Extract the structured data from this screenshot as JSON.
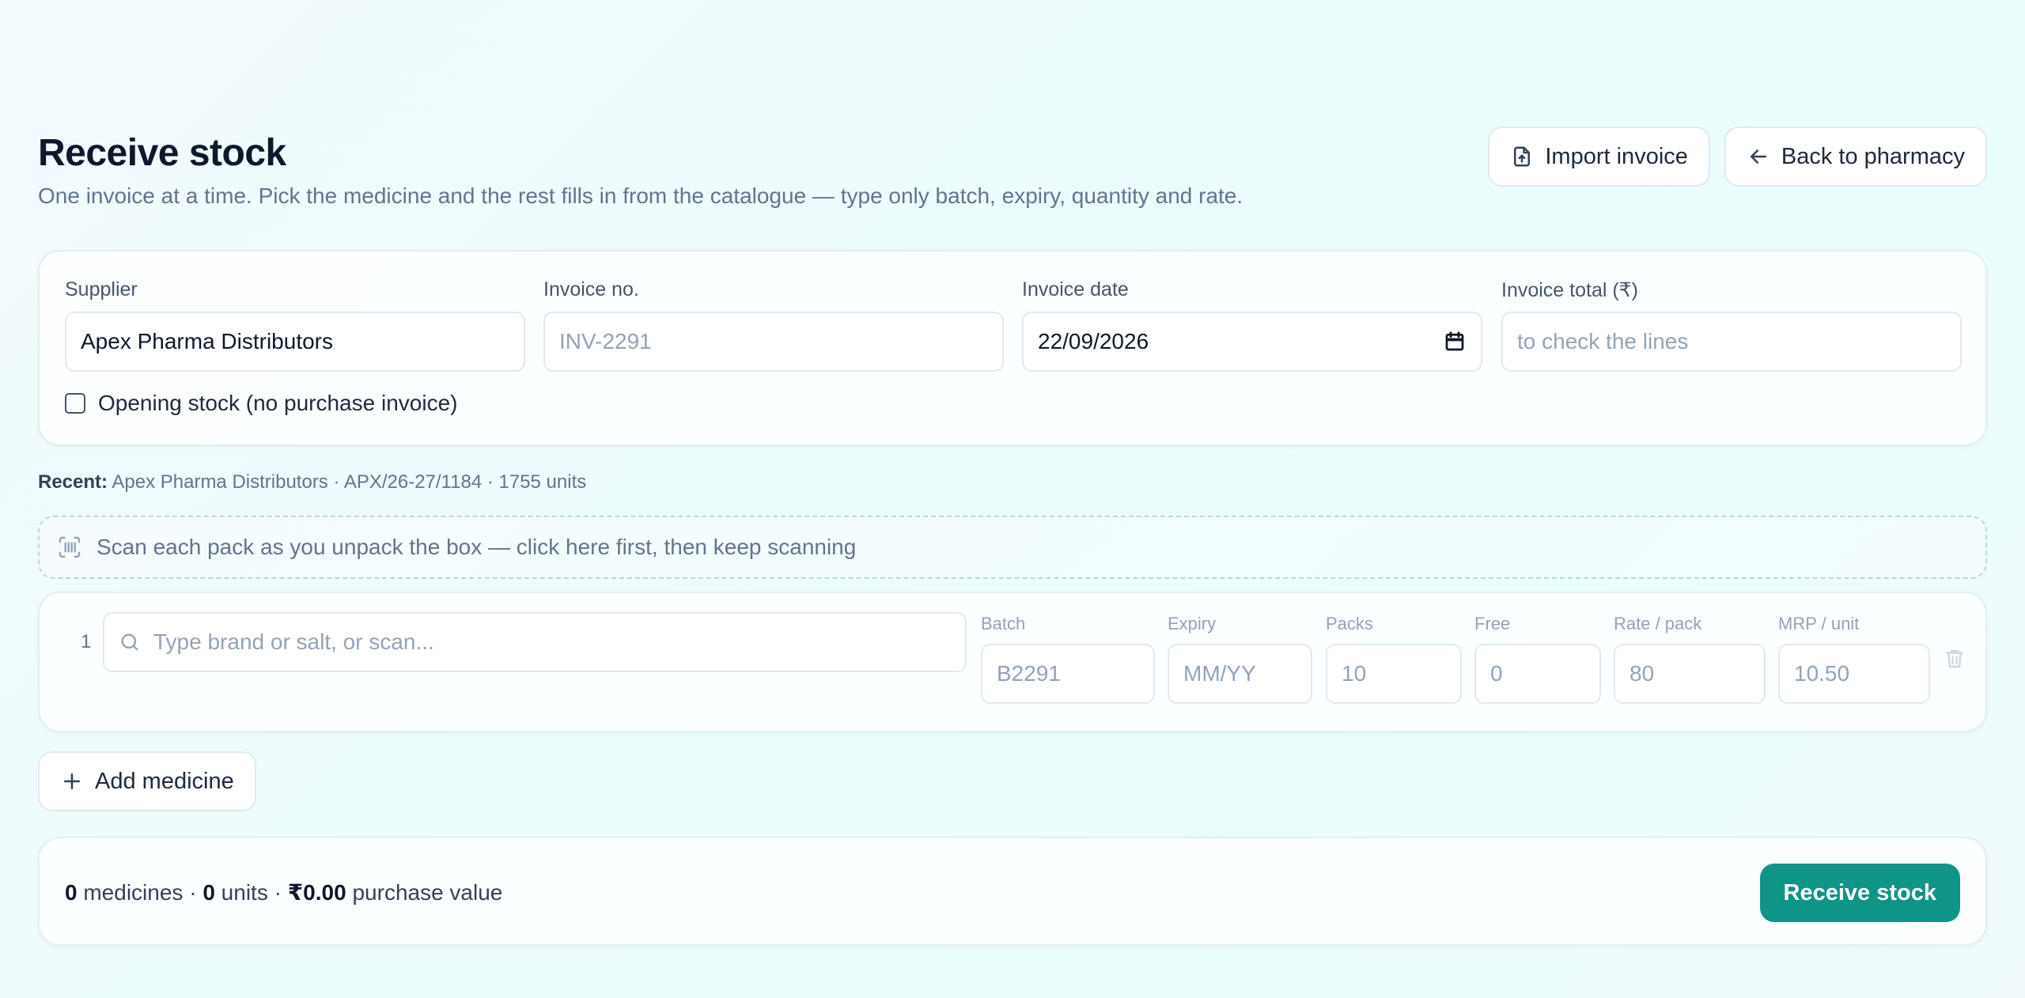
{
  "header": {
    "title": "Receive stock",
    "subtitle": "One invoice at a time. Pick the medicine and the rest fills in from the catalogue — type only batch, expiry, quantity and rate.",
    "import_label": "Import invoice",
    "back_label": "Back to pharmacy"
  },
  "invoice": {
    "supplier_label": "Supplier",
    "supplier_value": "Apex Pharma Distributors",
    "invoice_no_label": "Invoice no.",
    "invoice_no_placeholder": "INV-2291",
    "invoice_date_label": "Invoice date",
    "invoice_date_value": "22/09/2026",
    "invoice_total_label": "Invoice total (₹)",
    "invoice_total_placeholder": "to check the lines",
    "opening_stock_label": "Opening stock (no purchase invoice)"
  },
  "recent": {
    "label": "Recent:",
    "text": "Apex Pharma Distributors · APX/26-27/1184 · 1755 units"
  },
  "scan": {
    "placeholder": "Scan each pack as you unpack the box — click here first, then keep scanning"
  },
  "line": {
    "number": "1",
    "search_placeholder": "Type brand or salt, or scan...",
    "batch_label": "Batch",
    "batch_placeholder": "B2291",
    "expiry_label": "Expiry",
    "expiry_placeholder": "MM/YY",
    "packs_label": "Packs",
    "packs_placeholder": "10",
    "free_label": "Free",
    "free_placeholder": "0",
    "rate_label": "Rate / pack",
    "rate_placeholder": "80",
    "mrp_label": "MRP / unit",
    "mrp_placeholder": "10.50"
  },
  "add_medicine_label": "Add medicine",
  "summary": {
    "medicines_count": "0",
    "medicines_word": "medicines ·",
    "units_count": "0",
    "units_word": "units ·",
    "purchase_value": "₹0.00",
    "purchase_word": "purchase value",
    "receive_label": "Receive stock"
  },
  "colors": {
    "accent": "#0f9488"
  }
}
